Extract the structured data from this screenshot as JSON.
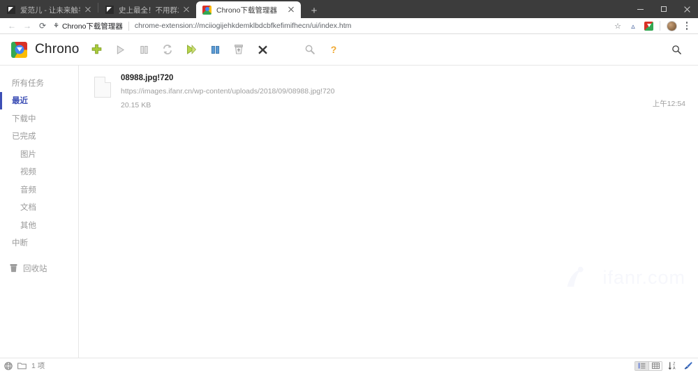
{
  "browser": {
    "tabs": [
      {
        "title": "爱范儿 - 让未来触手可及",
        "favicon": "document-favicon",
        "active": false
      },
      {
        "title": "史上最全！不用群发，这里总结",
        "favicon": "document-favicon",
        "active": false
      },
      {
        "title": "Chrono下载管理器",
        "favicon": "chrono-favicon",
        "active": true
      }
    ],
    "new_tab_label": "+",
    "window_controls": {
      "minimize": "—",
      "maximize": "▢",
      "close": "✕"
    },
    "nav": {
      "back": "←",
      "forward": "→",
      "reload": "⟳"
    },
    "address": {
      "extension_chip": "Chrono下载管理器",
      "url": "chrome-extension://mciiogijehkdemklbdcbfkefimifhecn/ui/index.htm",
      "puzzle_icon": "extension-puzzle-icon"
    },
    "omni_actions": [
      "star-icon",
      "extension-v-icon",
      "chrono-extension-icon",
      "profile-avatar",
      "menu-kebab-icon"
    ]
  },
  "app": {
    "brand": "Chrono",
    "toolbar": [
      {
        "name": "add-download-button",
        "icon": "plus-icon",
        "label": "新建下载"
      },
      {
        "name": "resume-button",
        "icon": "play-icon",
        "label": "继续"
      },
      {
        "name": "pause-button",
        "icon": "pause-icon",
        "label": "暂停"
      },
      {
        "name": "retry-button",
        "icon": "refresh-icon",
        "label": "重试"
      },
      {
        "name": "resume-all-button",
        "icon": "play-all-icon",
        "label": "全部继续"
      },
      {
        "name": "pause-all-button",
        "icon": "pause-all-icon",
        "label": "全部暂停"
      },
      {
        "name": "clear-button",
        "icon": "trash-icon",
        "label": "清除"
      },
      {
        "name": "cancel-button",
        "icon": "cross-icon",
        "label": "取消"
      },
      {
        "name": "search-downloads-button",
        "icon": "magnifier-icon",
        "label": "搜索"
      },
      {
        "name": "help-button",
        "icon": "question-mark-icon",
        "label": "帮助"
      }
    ],
    "header_search_icon": "search-icon",
    "sidebar": [
      {
        "label": "所有任务",
        "name": "sidebar-item-all-tasks",
        "active": false,
        "sub": false
      },
      {
        "label": "最近",
        "name": "sidebar-item-recent",
        "active": true,
        "sub": false
      },
      {
        "label": "下载中",
        "name": "sidebar-item-downloading",
        "active": false,
        "sub": false
      },
      {
        "label": "已完成",
        "name": "sidebar-item-completed",
        "active": false,
        "sub": false
      },
      {
        "label": "图片",
        "name": "sidebar-item-images",
        "active": false,
        "sub": true
      },
      {
        "label": "视频",
        "name": "sidebar-item-videos",
        "active": false,
        "sub": true
      },
      {
        "label": "音频",
        "name": "sidebar-item-audio",
        "active": false,
        "sub": true
      },
      {
        "label": "文档",
        "name": "sidebar-item-documents",
        "active": false,
        "sub": true
      },
      {
        "label": "其他",
        "name": "sidebar-item-other",
        "active": false,
        "sub": true
      },
      {
        "label": "中断",
        "name": "sidebar-item-interrupted",
        "active": false,
        "sub": false
      }
    ],
    "recycle_bin": {
      "label": "回收站",
      "icon": "trash-icon"
    },
    "downloads": [
      {
        "filename": "08988.jpg!720",
        "url": "https://images.ifanr.cn/wp-content/uploads/2018/09/08988.jpg!720",
        "size": "20.15 KB",
        "time": "上午12:54",
        "icon": "generic-file-icon"
      }
    ],
    "watermark": "ifanr.com",
    "statusbar": {
      "network_icon": "globe-icon",
      "folder_icon": "folder-icon",
      "count": "1 项",
      "view_list_icon": "list-view-icon",
      "view_grid_icon": "grid-view-icon",
      "sort_icon": "sort-az-icon",
      "clean_icon": "broom-icon"
    }
  },
  "colors": {
    "accent": "#3d4fb5",
    "tabstrip_bg": "#3c3c3c",
    "muted_text": "#9a9a9a",
    "plus_green": "#a5c63b",
    "help_orange": "#f0a830"
  }
}
